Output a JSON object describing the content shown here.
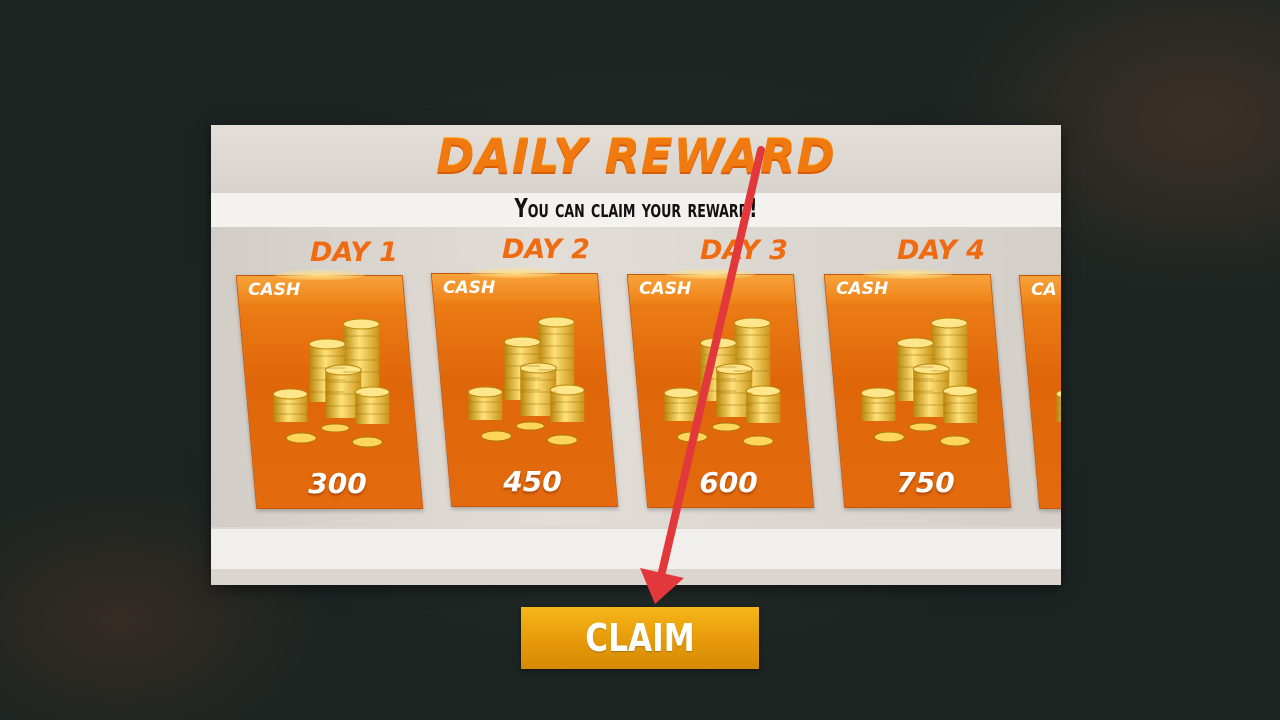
{
  "title": "DAILY REWARD",
  "subtitle": "You can claim your reward!",
  "rewards": [
    {
      "day": "DAY 1",
      "type": "CASH",
      "amount": "300"
    },
    {
      "day": "DAY 2",
      "type": "CASH",
      "amount": "450"
    },
    {
      "day": "DAY 3",
      "type": "CASH",
      "amount": "600"
    },
    {
      "day": "DAY 4",
      "type": "CASH",
      "amount": "750"
    },
    {
      "type": "CA"
    }
  ],
  "claim_label": "CLAIM",
  "colors": {
    "accent_orange": "#f07a10",
    "card_orange": "#e36a0d",
    "claim_gold": "#f0a811",
    "arrow_red": "#e2383c"
  }
}
